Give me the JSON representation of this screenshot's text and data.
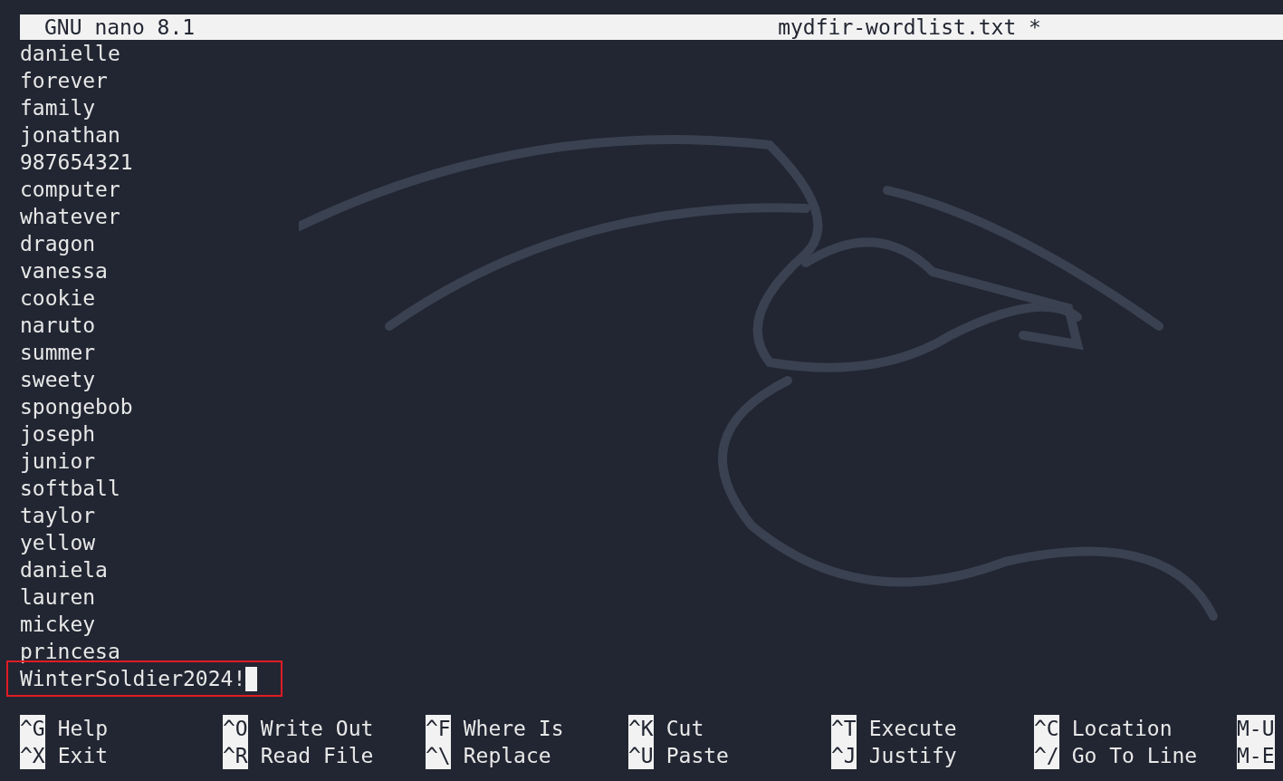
{
  "title_bar": {
    "app": "GNU nano 8.1",
    "filename": "mydfir-wordlist.txt *"
  },
  "lines": [
    {
      "text": "danielle",
      "highlighted": false,
      "cursor": false
    },
    {
      "text": "forever",
      "highlighted": false,
      "cursor": false
    },
    {
      "text": "family",
      "highlighted": false,
      "cursor": false
    },
    {
      "text": "jonathan",
      "highlighted": false,
      "cursor": false
    },
    {
      "text": "987654321",
      "highlighted": false,
      "cursor": false
    },
    {
      "text": "computer",
      "highlighted": false,
      "cursor": false
    },
    {
      "text": "whatever",
      "highlighted": false,
      "cursor": false
    },
    {
      "text": "dragon",
      "highlighted": false,
      "cursor": false
    },
    {
      "text": "vanessa",
      "highlighted": false,
      "cursor": false
    },
    {
      "text": "cookie",
      "highlighted": false,
      "cursor": false
    },
    {
      "text": "naruto",
      "highlighted": false,
      "cursor": false
    },
    {
      "text": "summer",
      "highlighted": false,
      "cursor": false
    },
    {
      "text": "sweety",
      "highlighted": false,
      "cursor": false
    },
    {
      "text": "spongebob",
      "highlighted": false,
      "cursor": false
    },
    {
      "text": "joseph",
      "highlighted": false,
      "cursor": false
    },
    {
      "text": "junior",
      "highlighted": false,
      "cursor": false
    },
    {
      "text": "softball",
      "highlighted": false,
      "cursor": false
    },
    {
      "text": "taylor",
      "highlighted": false,
      "cursor": false
    },
    {
      "text": "yellow",
      "highlighted": false,
      "cursor": false
    },
    {
      "text": "daniela",
      "highlighted": false,
      "cursor": false
    },
    {
      "text": "lauren",
      "highlighted": false,
      "cursor": false
    },
    {
      "text": "mickey",
      "highlighted": false,
      "cursor": false
    },
    {
      "text": "princesa",
      "highlighted": false,
      "cursor": false
    },
    {
      "text": "WinterSoldier2024!",
      "highlighted": true,
      "cursor": true
    }
  ],
  "shortcuts": [
    [
      {
        "key": "^G",
        "label": "Help"
      },
      {
        "key": "^O",
        "label": "Write Out"
      },
      {
        "key": "^F",
        "label": "Where Is"
      },
      {
        "key": "^K",
        "label": "Cut"
      },
      {
        "key": "^T",
        "label": "Execute"
      },
      {
        "key": "^C",
        "label": "Location"
      },
      {
        "key": "M-U"
      }
    ],
    [
      {
        "key": "^X",
        "label": "Exit"
      },
      {
        "key": "^R",
        "label": "Read File"
      },
      {
        "key": "^\\",
        "label": "Replace"
      },
      {
        "key": "^U",
        "label": "Paste"
      },
      {
        "key": "^J",
        "label": "Justify"
      },
      {
        "key": "^/",
        "label": "Go To Line"
      },
      {
        "key": "M-E"
      }
    ]
  ]
}
